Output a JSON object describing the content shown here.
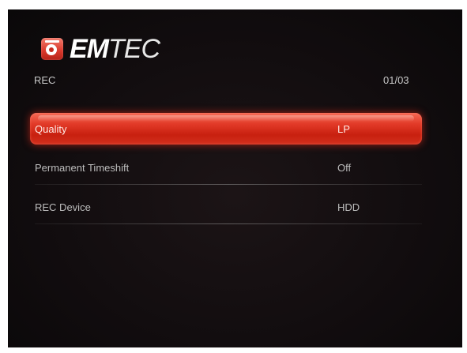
{
  "brand": {
    "name_bold": "EM",
    "name_thin": "TEC",
    "accent_color": "#d9382b"
  },
  "header": {
    "section_title": "REC",
    "page_counter": "01/03"
  },
  "menu": {
    "items": [
      {
        "label": "Quality",
        "value": "LP",
        "selected": true
      },
      {
        "label": "Permanent Timeshift",
        "value": "Off",
        "selected": false
      },
      {
        "label": "REC Device",
        "value": "HDD",
        "selected": false
      }
    ]
  },
  "icons": {
    "logo": "record-disc-icon"
  }
}
